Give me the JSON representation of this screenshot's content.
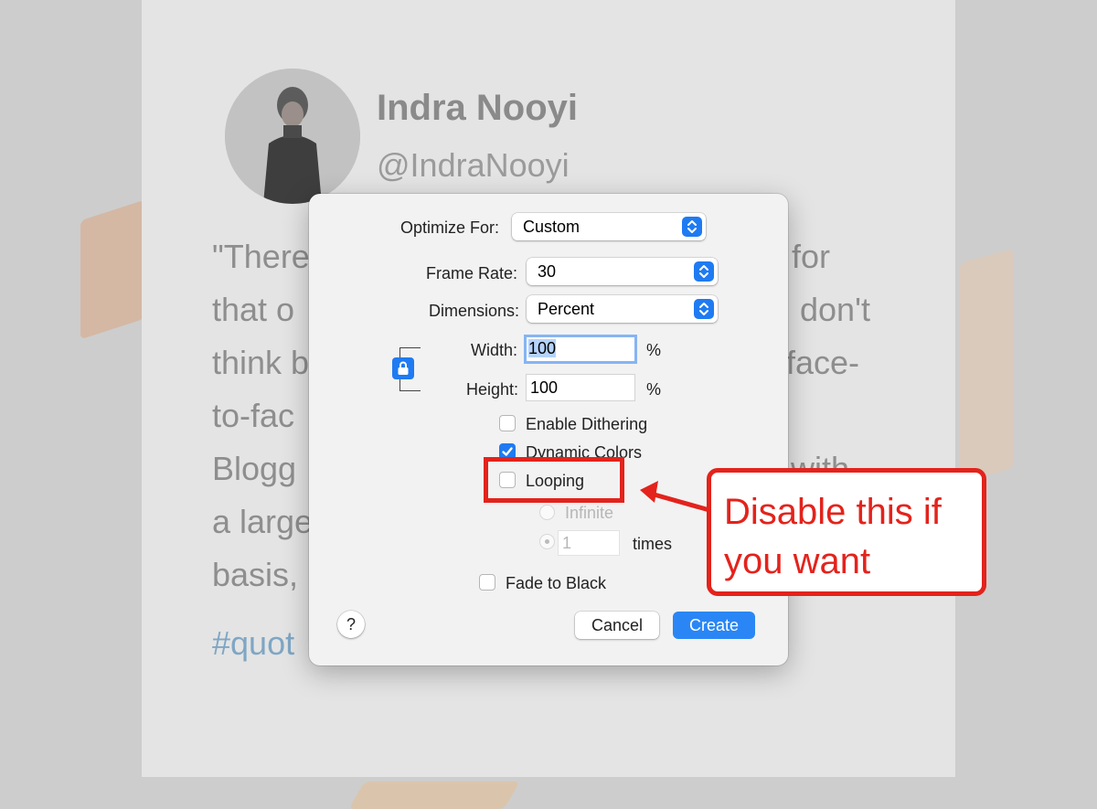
{
  "background": {
    "author_name": "Indra Nooyi",
    "author_handle": "@IndraNooyi",
    "quote_lines": [
      "\"There",
      "for",
      "that o",
      "don't",
      "think b",
      "face-",
      "to-fac",
      "Blogg",
      "with",
      "a large",
      "basis,"
    ],
    "hashtag": "#quot"
  },
  "dialog": {
    "optimize_for": {
      "label": "Optimize For:",
      "value": "Custom"
    },
    "frame_rate": {
      "label": "Frame Rate:",
      "value": "30"
    },
    "dimensions": {
      "label": "Dimensions:",
      "value": "Percent"
    },
    "width": {
      "label": "Width:",
      "value": "100",
      "unit": "%"
    },
    "height": {
      "label": "Height:",
      "value": "100",
      "unit": "%"
    },
    "enable_dithering": {
      "label": "Enable Dithering",
      "checked": false
    },
    "dynamic_colors": {
      "label": "Dynamic Colors",
      "checked": true
    },
    "looping": {
      "label": "Looping",
      "checked": false
    },
    "infinite": {
      "label": "Infinite"
    },
    "times": {
      "value": "1",
      "unit": "times"
    },
    "fade_to_black": {
      "label": "Fade to Black",
      "checked": false
    },
    "help_label": "?",
    "cancel_label": "Cancel",
    "create_label": "Create"
  },
  "annotation": {
    "callout_line1": "Disable this if",
    "callout_line2": "you want"
  },
  "colors": {
    "accent": "#1f7bf2",
    "annotation_red": "#e3231c"
  }
}
